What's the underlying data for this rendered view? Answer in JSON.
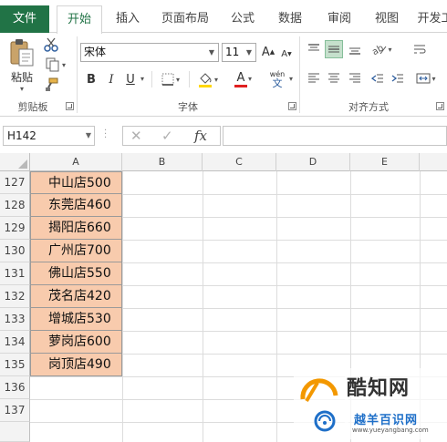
{
  "ribbon_tabs": {
    "file": "文件",
    "home": "开始",
    "insert": "插入",
    "page_layout": "页面布局",
    "formulas": "公式",
    "data": "数据",
    "review": "审阅",
    "view": "视图",
    "developer": "开发工"
  },
  "clipboard": {
    "paste_label": "粘贴",
    "group_label": "剪贴板"
  },
  "font": {
    "name": "宋体",
    "size": "11",
    "bold": "B",
    "italic": "I",
    "underline": "U",
    "grow": "A",
    "shrink": "A",
    "font_color": "A",
    "phonetic": "wén",
    "group_label": "字体"
  },
  "alignment": {
    "group_label": "对齐方式"
  },
  "formula_bar": {
    "name_box": "H142",
    "fx": "fx",
    "cancel": "✕",
    "enter": "✓"
  },
  "columns": [
    "A",
    "B",
    "C",
    "D",
    "E"
  ],
  "rows": [
    {
      "num": "127",
      "a": "中山店500"
    },
    {
      "num": "128",
      "a": "东莞店460"
    },
    {
      "num": "129",
      "a": "揭阳店660"
    },
    {
      "num": "130",
      "a": "广州店700"
    },
    {
      "num": "131",
      "a": "佛山店550"
    },
    {
      "num": "132",
      "a": "茂名店420"
    },
    {
      "num": "133",
      "a": "增城店530"
    },
    {
      "num": "134",
      "a": "萝岗店600"
    },
    {
      "num": "135",
      "a": "岗顶店490"
    },
    {
      "num": "136",
      "a": ""
    },
    {
      "num": "137",
      "a": ""
    }
  ],
  "watermark": {
    "line1": "酷知网",
    "line2": "越羊百识网",
    "url": "www.yueyangbang.com"
  },
  "colors": {
    "excel_green": "#217346",
    "cell_fill": "#f8cbad",
    "align_active": "#c5e0cc",
    "watermark_orange": "#f39800",
    "watermark_blue": "#1e6fc8"
  }
}
